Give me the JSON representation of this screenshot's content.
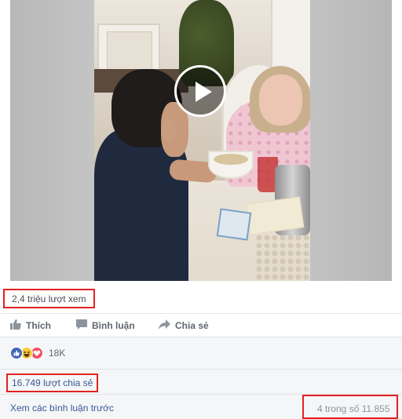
{
  "video": {
    "views": "2,4 triệu lượt xem",
    "play_icon": "play-icon"
  },
  "actions": {
    "like_label": "Thích",
    "comment_label": "Bình luận",
    "share_label": "Chia sẻ",
    "like_icon": "thumbs-up-icon",
    "comment_icon": "comment-icon",
    "share_icon": "share-arrow-icon"
  },
  "reactions": {
    "types": [
      "like",
      "haha",
      "love"
    ],
    "count": "18K",
    "colors": {
      "like": "#4267b2",
      "haha": "#f7c945",
      "love": "#f0505f"
    }
  },
  "shares": {
    "text": "16.749 lượt chia sẻ"
  },
  "comments": {
    "prev_link": "Xem các bình luận trước",
    "pager": "4 trong số 11.855"
  },
  "colors": {
    "highlight_border": "#e32222",
    "link": "#385898",
    "muted": "#90949c"
  }
}
